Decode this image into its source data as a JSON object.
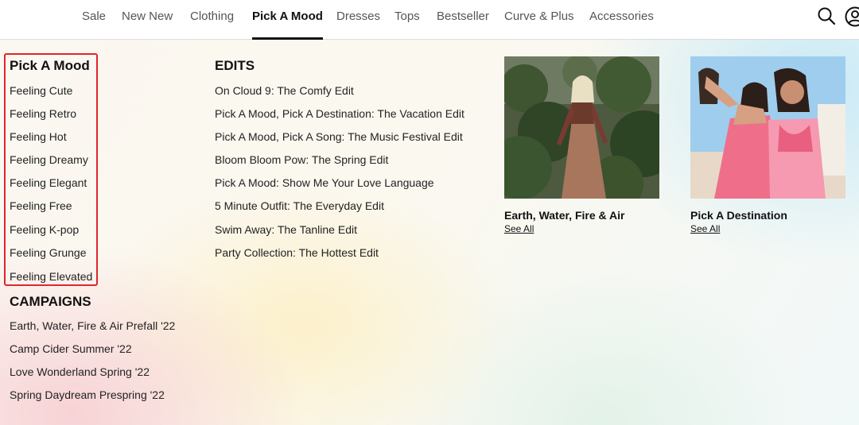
{
  "nav": {
    "items": [
      "Sale",
      "New New",
      "Clothing",
      "Pick A Mood",
      "Dresses",
      "Tops",
      "Bestseller",
      "Curve & Plus",
      "Accessories"
    ],
    "active": "Pick A Mood",
    "icons": [
      "search-icon",
      "account-icon"
    ]
  },
  "mood": {
    "heading": "Pick A Mood",
    "items": [
      "Feeling Cute",
      "Feeling Retro",
      "Feeling Hot",
      "Feeling Dreamy",
      "Feeling Elegant",
      "Feeling Free",
      "Feeling K-pop",
      "Feeling Grunge",
      "Feeling Elevated"
    ]
  },
  "campaigns": {
    "heading": "CAMPAIGNS",
    "items": [
      "Earth, Water, Fire & Air Prefall '22",
      "Camp Cider Summer '22",
      "Love Wonderland Spring '22",
      "Spring Daydream Prespring '22"
    ]
  },
  "edits": {
    "heading": "EDITS",
    "items": [
      "On Cloud 9: The Comfy Edit",
      "Pick A Mood, Pick A Destination: The Vacation Edit",
      "Pick A Mood, Pick A Song: The Music Festival Edit",
      "Bloom Bloom Pow: The Spring Edit",
      "Pick A Mood: Show Me Your Love Language",
      "5 Minute Outfit: The Everyday Edit",
      "Swim Away: The Tanline Edit",
      "Party Collection: The Hottest Edit"
    ]
  },
  "promos": [
    {
      "title": "Earth, Water, Fire & Air",
      "link": "See All"
    },
    {
      "title": "Pick A Destination",
      "link": "See All"
    }
  ],
  "colors": {
    "active_underline": "#111111",
    "highlight_box": "#e0262b"
  }
}
